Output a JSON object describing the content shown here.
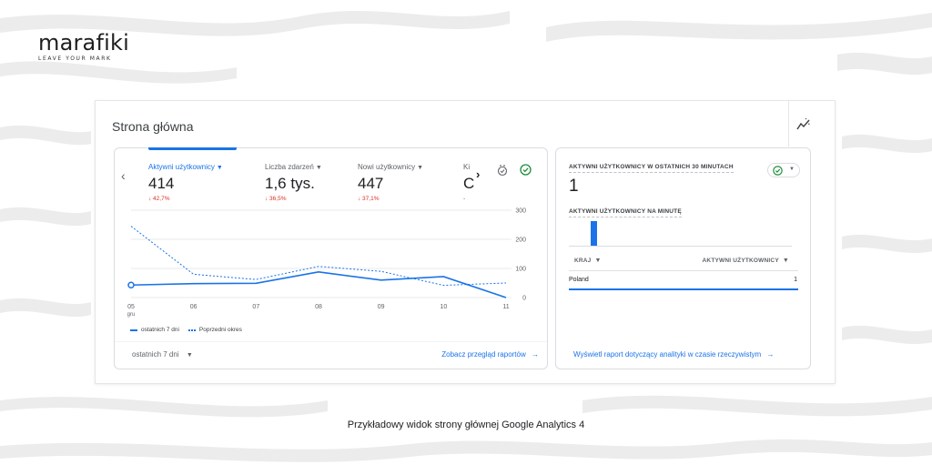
{
  "brand": {
    "name": "marafiki",
    "tagline": "LEAVE YOUR MARK"
  },
  "header": {
    "title": "Strona główna"
  },
  "overview": {
    "metrics": [
      {
        "label": "Aktywni użytkownicy",
        "value": "414",
        "change": "↓ 42,7%"
      },
      {
        "label": "Liczba zdarzeń",
        "value": "1,6 tys.",
        "change": "↓ 36,5%"
      },
      {
        "label": "Nowi użytkownicy",
        "value": "447",
        "change": "↓ 37,1%"
      },
      {
        "label": "Ki",
        "value": "C",
        "change": "-"
      }
    ],
    "legend": {
      "current": "ostatnich 7 dni",
      "previous": "Poprzedni okres"
    },
    "period_select": "ostatnich 7 dni",
    "view_link": "Zobacz przegląd raportów"
  },
  "chart_data": {
    "type": "line",
    "x": [
      "05",
      "06",
      "07",
      "08",
      "09",
      "10",
      "11"
    ],
    "x_sublabel": "gru",
    "yticks": [
      "300",
      "200",
      "100",
      "0"
    ],
    "ylim": [
      0,
      300
    ],
    "grid": true,
    "series": [
      {
        "name": "ostatnich 7 dni",
        "style": "solid",
        "values": [
          43,
          48,
          49,
          88,
          60,
          72,
          0
        ]
      },
      {
        "name": "Poprzedni okres",
        "style": "dashed",
        "values": [
          245,
          80,
          62,
          107,
          90,
          42,
          50
        ]
      }
    ],
    "colors": {
      "series": "#1a73e8",
      "grid": "#e8eaed",
      "axis_text": "#5f6368"
    }
  },
  "realtime": {
    "title": "AKTYWNI UŻYTKOWNICY W OSTATNICH 30 MINUTACH",
    "value": "1",
    "per_minute_label": "AKTYWNI UŻYTKOWNICY NA MINUTĘ",
    "per_minute_values": [
      1
    ],
    "table": {
      "columns": [
        "KRAJ",
        "AKTYWNI UŻYTKOWNICY"
      ],
      "rows": [
        {
          "country": "Poland",
          "users": "1"
        }
      ]
    },
    "link": "Wyświetl raport dotyczący analityki w czasie rzeczywistym"
  },
  "caption": "Przykładowy widok strony głównej Google Analytics 4",
  "colors": {
    "accent": "#1a73e8",
    "negative": "#d93025",
    "success": "#1e8e3e"
  }
}
